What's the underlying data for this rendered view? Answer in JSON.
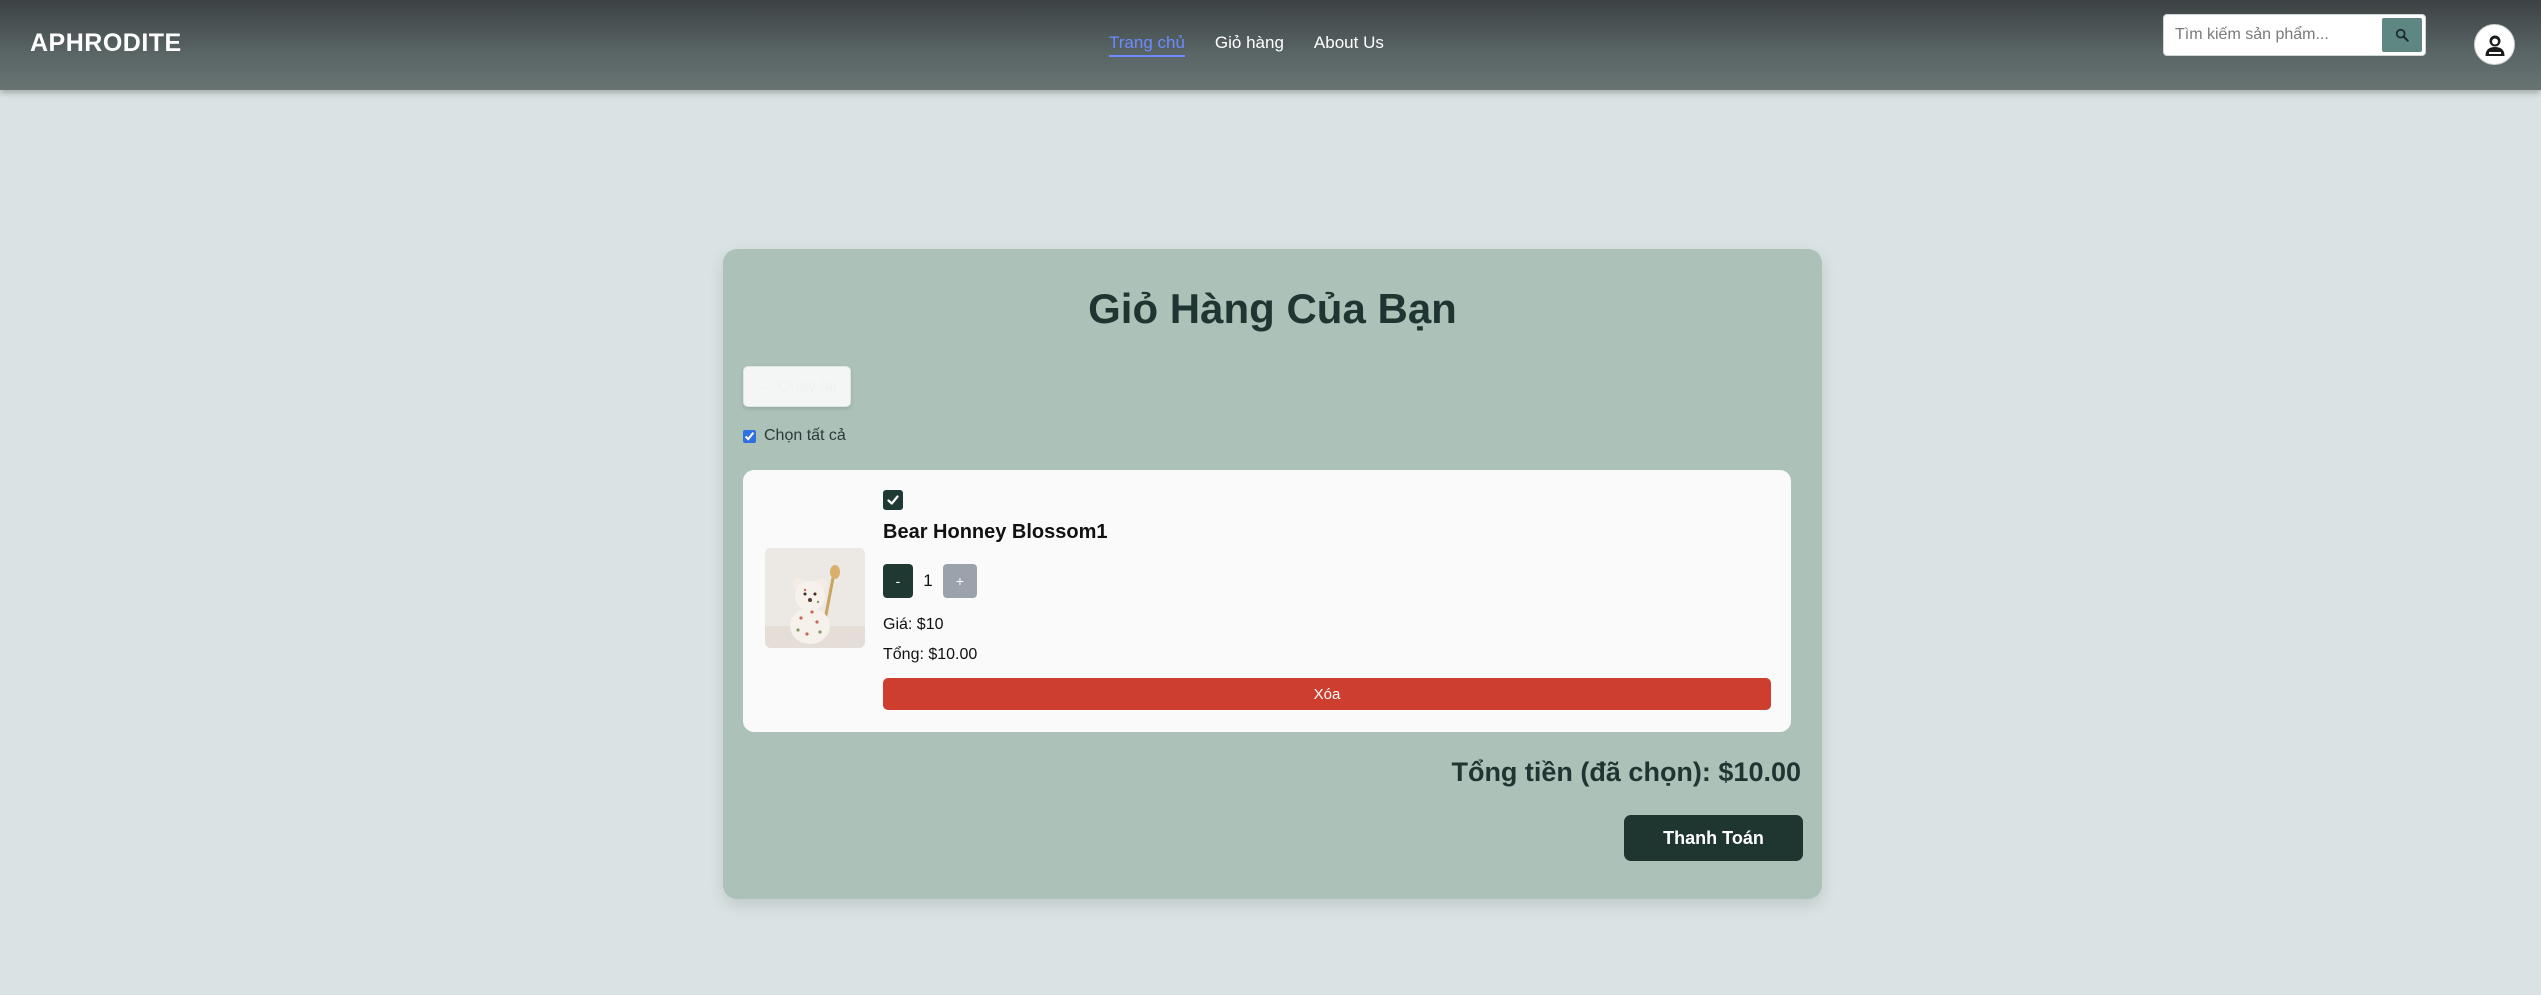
{
  "header": {
    "brand": "APHRODITE",
    "nav": [
      {
        "label": "Trang chủ",
        "active": true
      },
      {
        "label": "Giỏ hàng",
        "active": false
      },
      {
        "label": "About Us",
        "active": false
      }
    ],
    "search": {
      "placeholder": "Tìm kiếm sản phẩm...",
      "value": "",
      "button_icon": "search-icon"
    },
    "avatar_icon": "user-avatar-icon"
  },
  "cart": {
    "title": "Giỏ Hàng Của Bạn",
    "back_label": "← Quay lại",
    "select_all_label": "Chọn tất cả",
    "select_all_checked": true,
    "items": [
      {
        "selected": true,
        "name": "Bear Honney Blossom1",
        "image_icon": "teddy-bear-product-image",
        "qty_minus": "-",
        "quantity": "1",
        "qty_plus": "+",
        "price_text": "Giá: $10",
        "total_text": "Tổng: $10.00",
        "delete_label": "Xóa"
      }
    ],
    "grand_total_text": "Tổng tiền (đã chọn): $10.00",
    "checkout_label": "Thanh Toán"
  },
  "colors": {
    "page_bg": "#dae3e4",
    "card_bg": "#acc2b9",
    "accent_dark": "#1e3530",
    "active_link": "#6c8cff",
    "delete": "#cd3e2f",
    "search_button": "#5e8682"
  }
}
